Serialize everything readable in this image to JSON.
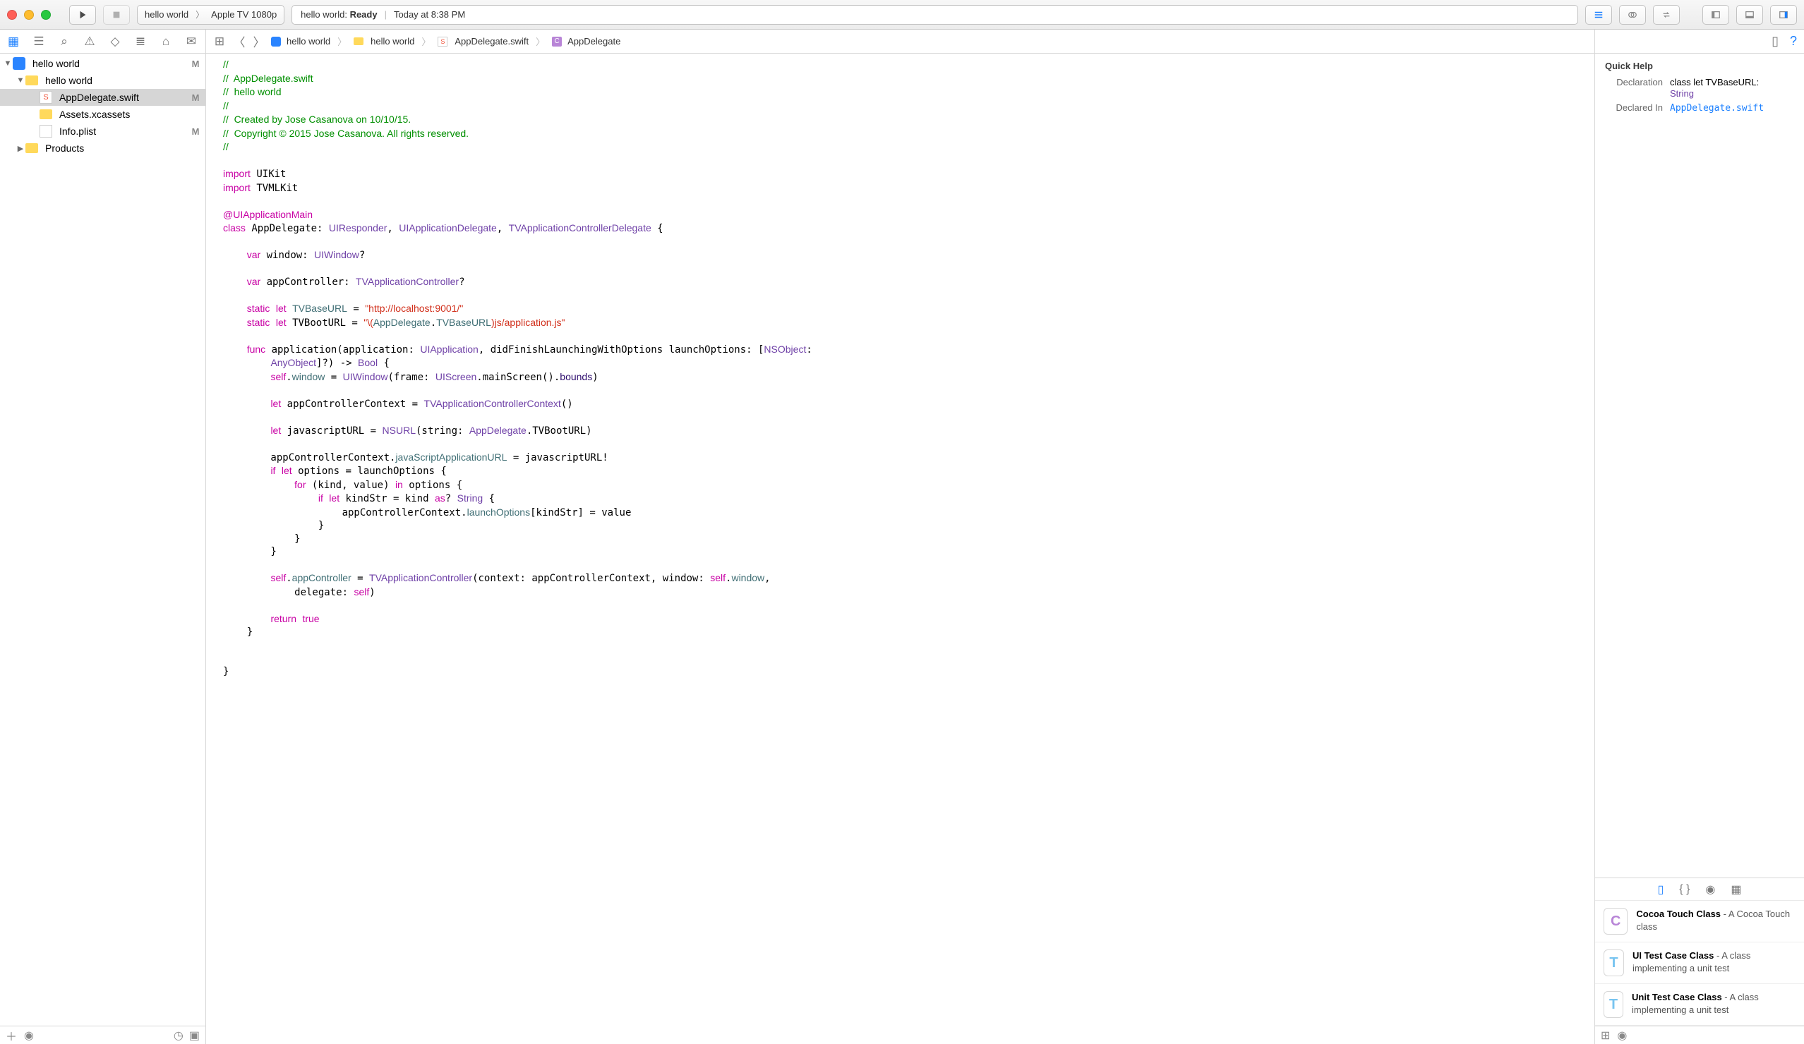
{
  "titlebar": {
    "scheme_target": "hello world",
    "scheme_dest": "Apple TV 1080p",
    "activity_prefix": "hello world:",
    "activity_status": "Ready",
    "activity_time": "Today at 8:38 PM"
  },
  "navigator": {
    "project": "hello world",
    "project_badge": "M",
    "group": "hello world",
    "files": [
      {
        "name": "AppDelegate.swift",
        "badge": "M",
        "kind": "swift",
        "selected": true
      },
      {
        "name": "Assets.xcassets",
        "badge": "",
        "kind": "assets"
      },
      {
        "name": "Info.plist",
        "badge": "M",
        "kind": "plist"
      }
    ],
    "products": "Products"
  },
  "jumpbar": {
    "p1": "hello world",
    "p2": "hello world",
    "p3": "AppDelegate.swift",
    "p4": "AppDelegate"
  },
  "code": {
    "file_header_file": "AppDelegate.swift",
    "file_header_proj": "hello world",
    "file_header_created": "Created by Jose Casanova on 10/10/15.",
    "file_header_copy": "Copyright © 2015 Jose Casanova. All rights reserved.",
    "tv_base_url": "\"http://localhost:9001/\"",
    "tv_boot_url_a": "\"\\(",
    "tv_boot_url_b": ")js/application.js\""
  },
  "inspector": {
    "title": "Quick Help",
    "decl_label": "Declaration",
    "decl_text_a": "class let TVBaseURL:",
    "decl_text_b": "String",
    "declared_label": "Declared In",
    "declared_file": "AppDelegate.swift"
  },
  "library": {
    "items": [
      {
        "icon": "C",
        "title": "Cocoa Touch Class",
        "desc": "A Cocoa Touch class"
      },
      {
        "icon": "T",
        "title": "UI Test Case Class",
        "desc": "A class implementing a unit test"
      },
      {
        "icon": "T",
        "title": "Unit Test Case Class",
        "desc": "A class implementing a unit test"
      }
    ]
  }
}
